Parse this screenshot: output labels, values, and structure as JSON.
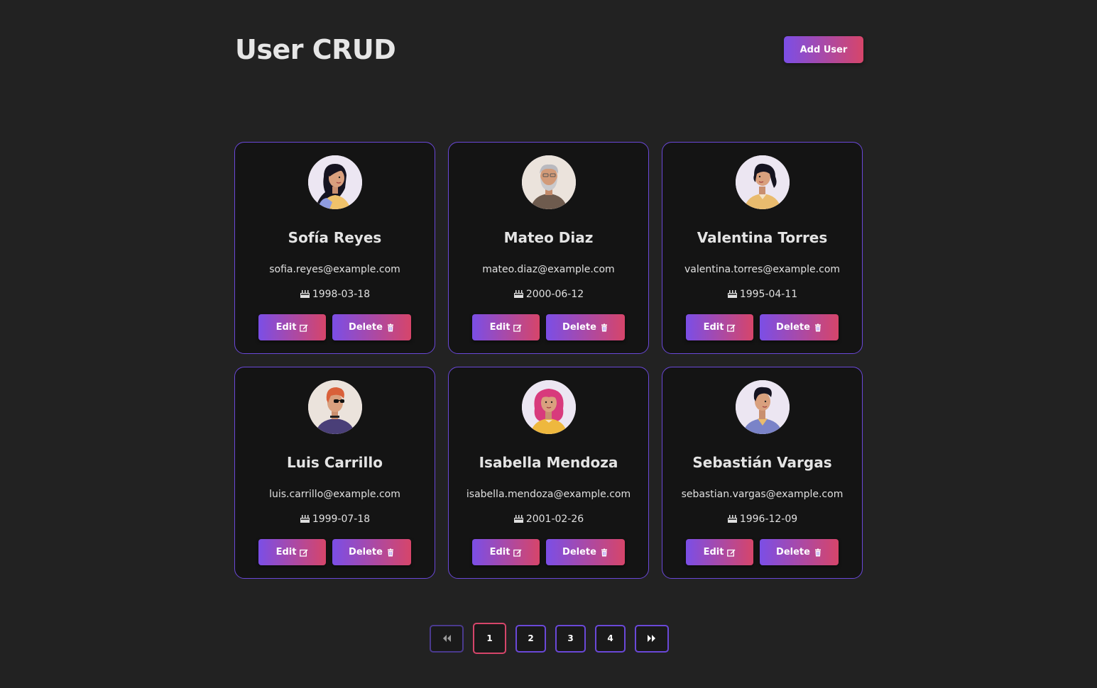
{
  "header": {
    "title": "User CRUD",
    "add_button_label": "Add User"
  },
  "accent_gradient": [
    "#7b4ee6",
    "#d6456a"
  ],
  "users": [
    {
      "name": "Sofía Reyes",
      "email": "sofia.reyes@example.com",
      "birthdate": "1998-03-18",
      "avatar_icon": "woman-long-black-hair-avatar"
    },
    {
      "name": "Mateo Diaz",
      "email": "mateo.diaz@example.com",
      "birthdate": "2000-06-12",
      "avatar_icon": "old-man-gray-beard-avatar"
    },
    {
      "name": "Valentina Torres",
      "email": "valentina.torres@example.com",
      "birthdate": "1995-04-11",
      "avatar_icon": "woman-black-hair-yellow-top-avatar"
    },
    {
      "name": "Luis Carrillo",
      "email": "luis.carrillo@example.com",
      "birthdate": "1999-07-18",
      "avatar_icon": "man-red-hair-sunglasses-avatar"
    },
    {
      "name": "Isabella Mendoza",
      "email": "isabella.mendoza@example.com",
      "birthdate": "2001-02-26",
      "avatar_icon": "woman-pink-hair-avatar"
    },
    {
      "name": "Sebastián Vargas",
      "email": "sebastian.vargas@example.com",
      "birthdate": "1996-12-09",
      "avatar_icon": "man-black-hair-blue-shirt-avatar"
    }
  ],
  "card_actions": {
    "edit_label": "Edit",
    "delete_label": "Delete"
  },
  "pagination": {
    "first_icon": "double-chevron-left-icon",
    "pages": [
      "1",
      "2",
      "3",
      "4"
    ],
    "active_page": "1",
    "last_icon": "double-chevron-right-icon"
  }
}
